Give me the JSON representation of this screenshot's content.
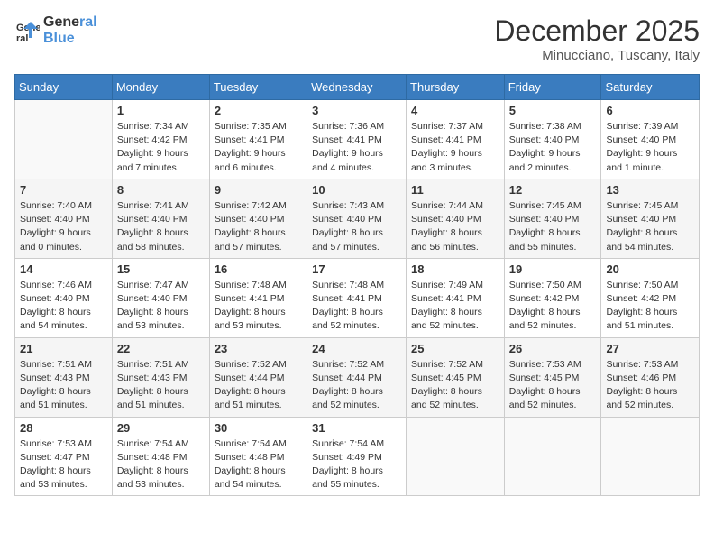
{
  "logo": {
    "line1": "General",
    "line2": "Blue"
  },
  "title": "December 2025",
  "subtitle": "Minucciano, Tuscany, Italy",
  "days_of_week": [
    "Sunday",
    "Monday",
    "Tuesday",
    "Wednesday",
    "Thursday",
    "Friday",
    "Saturday"
  ],
  "weeks": [
    [
      {
        "day": "",
        "info": ""
      },
      {
        "day": "1",
        "info": "Sunrise: 7:34 AM\nSunset: 4:42 PM\nDaylight: 9 hours\nand 7 minutes."
      },
      {
        "day": "2",
        "info": "Sunrise: 7:35 AM\nSunset: 4:41 PM\nDaylight: 9 hours\nand 6 minutes."
      },
      {
        "day": "3",
        "info": "Sunrise: 7:36 AM\nSunset: 4:41 PM\nDaylight: 9 hours\nand 4 minutes."
      },
      {
        "day": "4",
        "info": "Sunrise: 7:37 AM\nSunset: 4:41 PM\nDaylight: 9 hours\nand 3 minutes."
      },
      {
        "day": "5",
        "info": "Sunrise: 7:38 AM\nSunset: 4:40 PM\nDaylight: 9 hours\nand 2 minutes."
      },
      {
        "day": "6",
        "info": "Sunrise: 7:39 AM\nSunset: 4:40 PM\nDaylight: 9 hours\nand 1 minute."
      }
    ],
    [
      {
        "day": "7",
        "info": "Sunrise: 7:40 AM\nSunset: 4:40 PM\nDaylight: 9 hours\nand 0 minutes."
      },
      {
        "day": "8",
        "info": "Sunrise: 7:41 AM\nSunset: 4:40 PM\nDaylight: 8 hours\nand 58 minutes."
      },
      {
        "day": "9",
        "info": "Sunrise: 7:42 AM\nSunset: 4:40 PM\nDaylight: 8 hours\nand 57 minutes."
      },
      {
        "day": "10",
        "info": "Sunrise: 7:43 AM\nSunset: 4:40 PM\nDaylight: 8 hours\nand 57 minutes."
      },
      {
        "day": "11",
        "info": "Sunrise: 7:44 AM\nSunset: 4:40 PM\nDaylight: 8 hours\nand 56 minutes."
      },
      {
        "day": "12",
        "info": "Sunrise: 7:45 AM\nSunset: 4:40 PM\nDaylight: 8 hours\nand 55 minutes."
      },
      {
        "day": "13",
        "info": "Sunrise: 7:45 AM\nSunset: 4:40 PM\nDaylight: 8 hours\nand 54 minutes."
      }
    ],
    [
      {
        "day": "14",
        "info": "Sunrise: 7:46 AM\nSunset: 4:40 PM\nDaylight: 8 hours\nand 54 minutes."
      },
      {
        "day": "15",
        "info": "Sunrise: 7:47 AM\nSunset: 4:40 PM\nDaylight: 8 hours\nand 53 minutes."
      },
      {
        "day": "16",
        "info": "Sunrise: 7:48 AM\nSunset: 4:41 PM\nDaylight: 8 hours\nand 53 minutes."
      },
      {
        "day": "17",
        "info": "Sunrise: 7:48 AM\nSunset: 4:41 PM\nDaylight: 8 hours\nand 52 minutes."
      },
      {
        "day": "18",
        "info": "Sunrise: 7:49 AM\nSunset: 4:41 PM\nDaylight: 8 hours\nand 52 minutes."
      },
      {
        "day": "19",
        "info": "Sunrise: 7:50 AM\nSunset: 4:42 PM\nDaylight: 8 hours\nand 52 minutes."
      },
      {
        "day": "20",
        "info": "Sunrise: 7:50 AM\nSunset: 4:42 PM\nDaylight: 8 hours\nand 51 minutes."
      }
    ],
    [
      {
        "day": "21",
        "info": "Sunrise: 7:51 AM\nSunset: 4:43 PM\nDaylight: 8 hours\nand 51 minutes."
      },
      {
        "day": "22",
        "info": "Sunrise: 7:51 AM\nSunset: 4:43 PM\nDaylight: 8 hours\nand 51 minutes."
      },
      {
        "day": "23",
        "info": "Sunrise: 7:52 AM\nSunset: 4:44 PM\nDaylight: 8 hours\nand 51 minutes."
      },
      {
        "day": "24",
        "info": "Sunrise: 7:52 AM\nSunset: 4:44 PM\nDaylight: 8 hours\nand 52 minutes."
      },
      {
        "day": "25",
        "info": "Sunrise: 7:52 AM\nSunset: 4:45 PM\nDaylight: 8 hours\nand 52 minutes."
      },
      {
        "day": "26",
        "info": "Sunrise: 7:53 AM\nSunset: 4:45 PM\nDaylight: 8 hours\nand 52 minutes."
      },
      {
        "day": "27",
        "info": "Sunrise: 7:53 AM\nSunset: 4:46 PM\nDaylight: 8 hours\nand 52 minutes."
      }
    ],
    [
      {
        "day": "28",
        "info": "Sunrise: 7:53 AM\nSunset: 4:47 PM\nDaylight: 8 hours\nand 53 minutes."
      },
      {
        "day": "29",
        "info": "Sunrise: 7:54 AM\nSunset: 4:48 PM\nDaylight: 8 hours\nand 53 minutes."
      },
      {
        "day": "30",
        "info": "Sunrise: 7:54 AM\nSunset: 4:48 PM\nDaylight: 8 hours\nand 54 minutes."
      },
      {
        "day": "31",
        "info": "Sunrise: 7:54 AM\nSunset: 4:49 PM\nDaylight: 8 hours\nand 55 minutes."
      },
      {
        "day": "",
        "info": ""
      },
      {
        "day": "",
        "info": ""
      },
      {
        "day": "",
        "info": ""
      }
    ]
  ]
}
